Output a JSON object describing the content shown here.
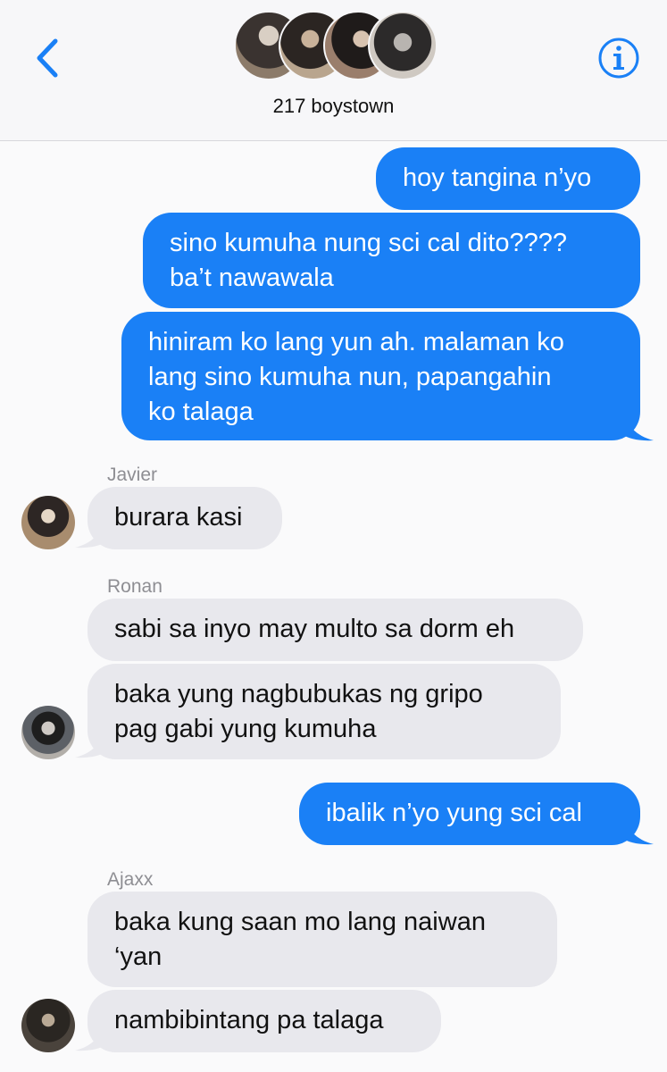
{
  "header": {
    "group_name": "217 boystown",
    "back_icon": "chevron-left-icon",
    "info_icon": "info-icon",
    "accent": "#1a80f6"
  },
  "messages": [
    {
      "type": "out",
      "lines": [
        "hoy tangina n’yo"
      ]
    },
    {
      "type": "out",
      "lines": [
        "sino kumuha nung sci cal dito????",
        "ba’t nawawala"
      ]
    },
    {
      "type": "out",
      "lines": [
        "hiniram ko lang yun ah. malaman ko",
        "lang sino kumuha nun, papangahin",
        "ko talaga"
      ]
    },
    {
      "type": "in",
      "sender": "Javier",
      "lines": [
        "burara kasi"
      ]
    },
    {
      "type": "in",
      "sender": "Ronan",
      "lines": [
        "sabi sa inyo may multo sa dorm eh"
      ]
    },
    {
      "type": "in",
      "lines": [
        "baka yung nagbubukas ng gripo",
        "pag gabi yung kumuha"
      ]
    },
    {
      "type": "out",
      "lines": [
        "ibalik n’yo yung sci cal"
      ]
    },
    {
      "type": "in",
      "sender": "Ajaxx",
      "lines": [
        "baka kung saan mo lang naiwan",
        "‘yan"
      ]
    },
    {
      "type": "in",
      "lines": [
        "nambibintang pa talaga"
      ]
    }
  ],
  "colors": {
    "outgoing_bubble": "#1a80f6",
    "incoming_bubble": "#e8e8ed",
    "sender_label": "#8e8e93"
  }
}
